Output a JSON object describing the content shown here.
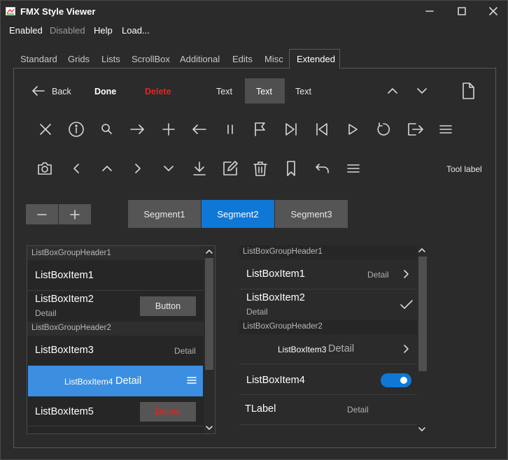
{
  "window": {
    "title": "FMX Style Viewer",
    "controls": [
      "minimize-icon",
      "maximize-icon",
      "close-icon"
    ]
  },
  "menu": {
    "items": [
      {
        "label": "Enabled",
        "enabled": true
      },
      {
        "label": "Disabled",
        "enabled": false
      },
      {
        "label": "Help",
        "enabled": true
      },
      {
        "label": "Load...",
        "enabled": true
      }
    ]
  },
  "tabs": {
    "items": [
      "Standard",
      "Grids",
      "Lists",
      "ScrollBox",
      "Additional",
      "Edits",
      "Misc",
      "Extended"
    ],
    "active": "Extended"
  },
  "toolbar1": {
    "back_label": "Back",
    "done_label": "Done",
    "delete_label": "Delete",
    "text1": "Text",
    "text2": "Text",
    "text3": "Text"
  },
  "toolbar3": {
    "tool_label": "Tool label"
  },
  "segments": {
    "items": [
      "Segment1",
      "Segment2",
      "Segment3"
    ],
    "selected": "Segment2"
  },
  "listbox_left": {
    "group1": "ListBoxGroupHeader1",
    "item1": "ListBoxItem1",
    "item2": "ListBoxItem2",
    "item2_detail": "Detail",
    "item2_button": "Button",
    "group2": "ListBoxGroupHeader2",
    "item3": "ListBoxItem3",
    "item3_detail": "Detail",
    "item4": "ListBoxItem4",
    "item4_detail": "Detail",
    "item5": "ListBoxItem5",
    "item5_button": "Delete"
  },
  "listbox_right": {
    "group1": "ListBoxGroupHeader1",
    "item1": "ListBoxItem1",
    "item1_detail": "Detail",
    "item2": "ListBoxItem2",
    "item2_detail": "Detail",
    "group2": "ListBoxGroupHeader2",
    "item3": "ListBoxItem3",
    "item3_detail": "Detail",
    "item4": "ListBoxItem4",
    "item4_switch_on": true,
    "label": "TLabel",
    "label_detail": "Detail"
  },
  "colors": {
    "accent": "#0f78d7",
    "selected_row": "#3c8ee0",
    "danger": "#e8231c",
    "background": "#2b2b2b"
  }
}
